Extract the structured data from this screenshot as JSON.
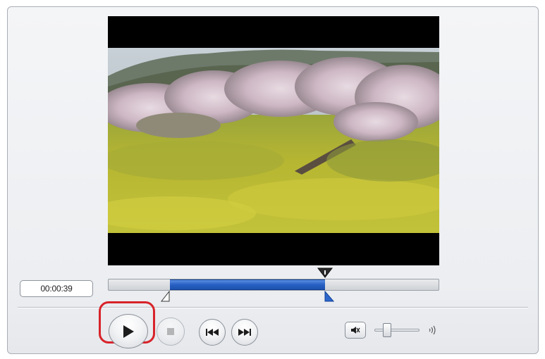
{
  "time_display": {
    "value": "00:00:39"
  },
  "playback": {
    "timeline_position_fraction": 0.655,
    "selection_start_fraction": 0.187,
    "selection_end_fraction": 0.655
  },
  "volume": {
    "level_fraction": 0.28
  },
  "colors": {
    "selection": "#2760c4",
    "highlight": "#d8232a",
    "video_background": "#000000"
  },
  "icons": {
    "play": "play-icon",
    "stop": "stop-icon",
    "previous": "skip-previous-icon",
    "next": "skip-next-icon",
    "mute": "speaker-mute-icon",
    "volume_max": "speaker-loud-icon",
    "playhead": "playhead-marker-icon"
  }
}
